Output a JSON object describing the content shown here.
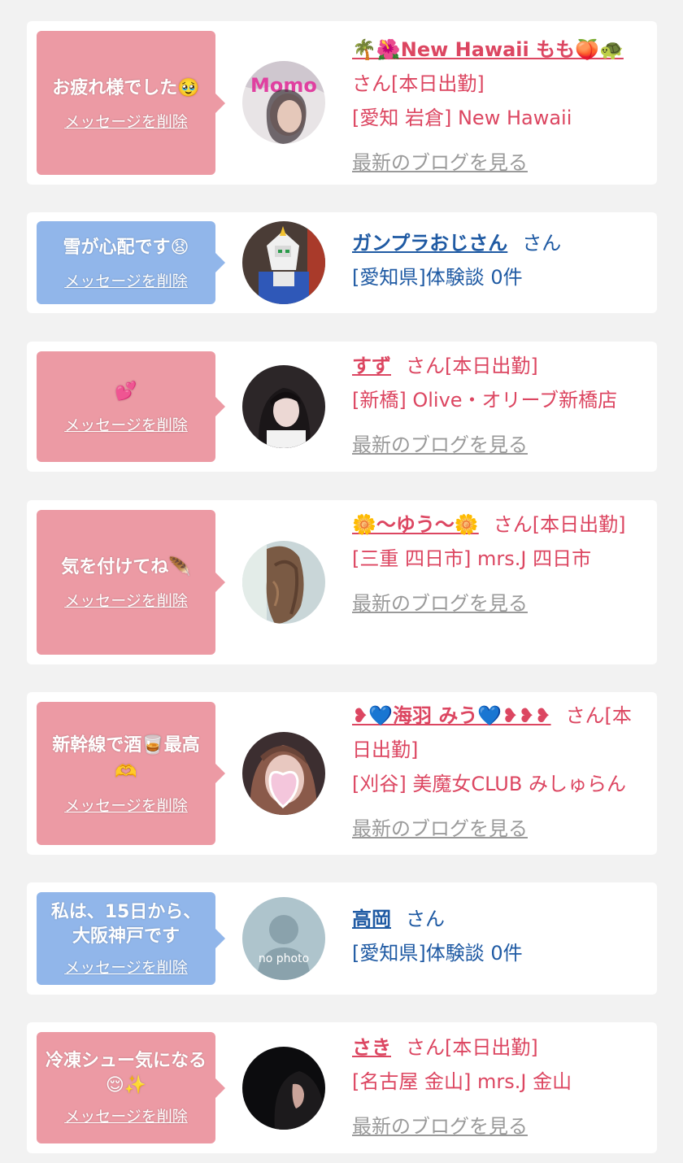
{
  "common": {
    "delete_label": "メッセージを削除",
    "blog_label": "最新のブログを見る",
    "san": "さん"
  },
  "entries": [
    {
      "bubble_color": "pink",
      "message": "お疲れ様でした🥹",
      "name": "🌴🌺New Hawaii もも🍑🐢",
      "name_suffix": "さん[本日出勤]",
      "shop": "[愛知 岩倉] New Hawaii",
      "has_blog": true
    },
    {
      "bubble_color": "blue",
      "message": "雪が心配です😧",
      "name": "ガンプラおじさん",
      "name_suffix": "さん",
      "shop": "[愛知県]体験談 0件",
      "has_blog": false
    },
    {
      "bubble_color": "pink",
      "message": "💕",
      "name": "すず",
      "name_suffix": "さん[本日出勤]",
      "shop": "[新橋] Olive・オリーブ新橋店",
      "has_blog": true
    },
    {
      "bubble_color": "pink",
      "message": "気を付けてね🪶",
      "name": "🌼〜ゆう〜🌼",
      "name_suffix": "さん[本日出勤]",
      "shop": "[三重 四日市] mrs.J 四日市",
      "has_blog": true
    },
    {
      "bubble_color": "pink",
      "message": "新幹線で酒🥃最高🫶",
      "name": "❥💙海羽 みう💙❥❥❥",
      "name_suffix": "さん[本日出勤]",
      "shop": "[刈谷] 美魔女CLUB みしゅらん",
      "has_blog": true
    },
    {
      "bubble_color": "blue",
      "message": "私は、15日から、大阪神戸です",
      "name": "高岡",
      "name_suffix": "さん",
      "shop": "[愛知県]体験談 0件",
      "has_blog": false
    },
    {
      "bubble_color": "pink",
      "message": "冷凍シュー気になる😌✨",
      "name": "さき",
      "name_suffix": "さん[本日出勤]",
      "shop": "[名古屋 金山] mrs.J 金山",
      "has_blog": true
    }
  ],
  "avatar_labels": {
    "no_photo": "no photo"
  }
}
